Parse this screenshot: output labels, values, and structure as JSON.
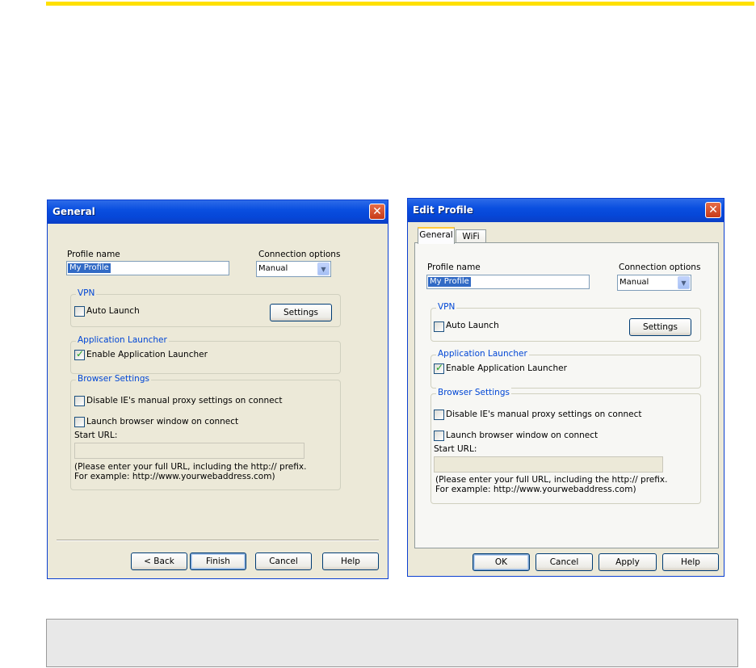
{
  "general": {
    "title": "General",
    "profile_name_label": "Profile name",
    "profile_name_value": "My Profile",
    "connection_options_label": "Connection options",
    "connection_value": "Manual",
    "vpn_group": "VPN",
    "auto_launch": "Auto Launch",
    "settings": "Settings",
    "app_launcher_group": "Application Launcher",
    "enable_app_launcher": "Enable Application Launcher",
    "browser_group": "Browser Settings",
    "disable_proxy": "Disable IE's manual proxy settings on connect",
    "launch_browser": "Launch browser window on connect",
    "start_url_label": "Start URL:",
    "hint_line1": "(Please enter your full URL, including the http:// prefix.",
    "hint_line2": "For example: http://www.yourwebaddress.com)",
    "back": "< Back",
    "finish": "Finish",
    "cancel": "Cancel",
    "help": "Help"
  },
  "edit": {
    "title": "Edit Profile",
    "tab_general": "General",
    "tab_wifi": "WiFi",
    "profile_name_label": "Profile name",
    "profile_name_value": "My Profile",
    "connection_options_label": "Connection options",
    "connection_value": "Manual",
    "vpn_group": "VPN",
    "auto_launch": "Auto Launch",
    "settings": "Settings",
    "app_launcher_group": "Application Launcher",
    "enable_app_launcher": "Enable Application Launcher",
    "browser_group": "Browser Settings",
    "disable_proxy": "Disable IE's manual proxy settings on connect",
    "launch_browser": "Launch browser window on connect",
    "start_url_label": "Start URL:",
    "hint_line1": "(Please enter your full URL, including the http:// prefix.",
    "hint_line2": "For example: http://www.yourwebaddress.com)",
    "ok": "OK",
    "cancel": "Cancel",
    "apply": "Apply",
    "help": "Help"
  },
  "colors": {
    "accent_bar": "#ffe000",
    "titlebar": "#0a4fe0",
    "group_title": "#0046d5"
  },
  "icons": [
    "close-icon",
    "chevron-down-icon",
    "checkmark-icon"
  ]
}
